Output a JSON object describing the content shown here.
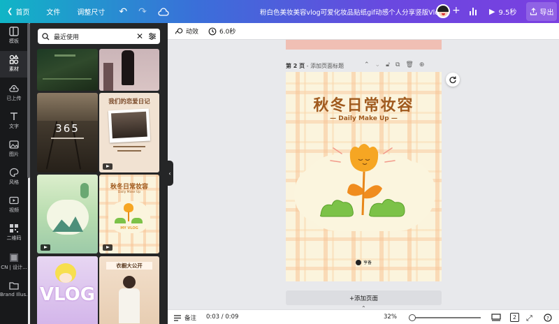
{
  "topbar": {
    "home": "首页",
    "file": "文件",
    "resize": "调整尺寸",
    "title": "粉白色美妆美容vlog可爱化妆品贴纸gif动感个人分享竖版Vlog",
    "play_duration": "9.5秒",
    "export": "导出"
  },
  "sidebar": {
    "items": [
      {
        "label": "模板",
        "icon": "template-icon"
      },
      {
        "label": "素材",
        "icon": "elements-icon"
      },
      {
        "label": "已上传",
        "icon": "upload-icon"
      },
      {
        "label": "文字",
        "icon": "text-icon"
      },
      {
        "label": "图片",
        "icon": "photo-icon"
      },
      {
        "label": "风格",
        "icon": "style-icon"
      },
      {
        "label": "视频",
        "icon": "video-icon"
      },
      {
        "label": "二维码",
        "icon": "qrcode-icon"
      },
      {
        "label": "CN | 设计...",
        "icon": "brand-kit-icon"
      },
      {
        "label": "Brand Illus...",
        "icon": "folder-icon"
      }
    ]
  },
  "panel": {
    "search_value": "最近使用",
    "thumbnails": {
      "t2_text": "365",
      "t4_text": "我们的恋爱日记",
      "t6_title": "秋冬日常妆容",
      "t6_sub": "Daily Make Up",
      "t6_tag": "MY VLOG",
      "t7_text": "VLOG",
      "t8_text": "衣橱大公开"
    }
  },
  "toolbar2": {
    "animate": "动效",
    "duration": "6.0秒"
  },
  "page": {
    "header_label": "第 2 页",
    "header_placeholder": " - 添加页面标题",
    "title": "秋冬日常妆容",
    "subtitle": "— Daily Make Up —",
    "brand": "亨备"
  },
  "add_page": "+添加页面",
  "bottombar": {
    "notes": "备注",
    "time": "0:03 / 0:09",
    "zoom": "32%",
    "page_count": "2"
  }
}
